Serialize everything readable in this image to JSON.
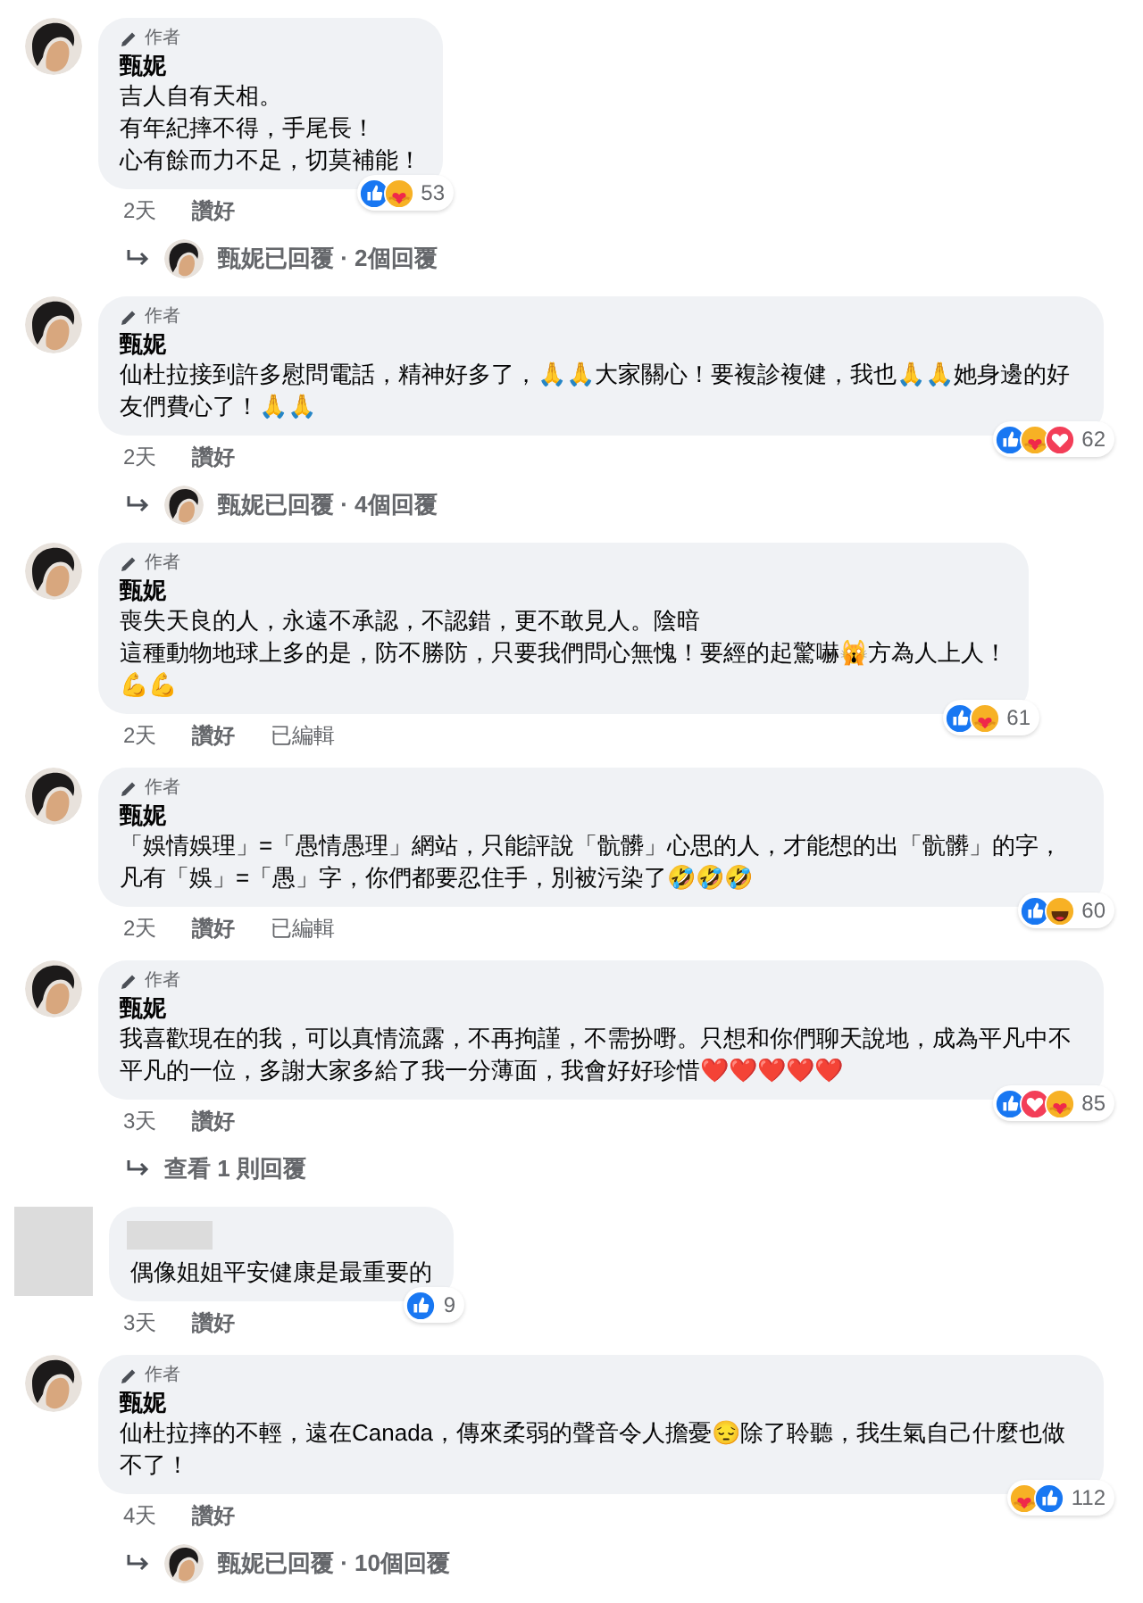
{
  "comments": [
    {
      "redacted_author": false,
      "badge": "作者",
      "name": "甄妮",
      "lines": [
        "吉人自有天相。",
        "有年紀摔不得，手尾長！",
        "心有餘而力不足，切莫補能！"
      ],
      "time": "2天",
      "actions": [
        "讚好"
      ],
      "reactions": [
        {
          "kind": "like"
        },
        {
          "kind": "care"
        }
      ],
      "reaction_count": "53",
      "replies": {
        "kind": "author",
        "text": "甄妮已回覆 · 2個回覆"
      }
    },
    {
      "redacted_author": false,
      "badge": "作者",
      "name": "甄妮",
      "lines": [
        "仙杜拉接到許多慰問電話，精神好多了，🙏🙏大家關心！要複診複健，我也🙏🙏她身邊的好友們費心了！🙏🙏"
      ],
      "time": "2天",
      "actions": [
        "讚好"
      ],
      "reactions": [
        {
          "kind": "like"
        },
        {
          "kind": "care"
        },
        {
          "kind": "love"
        }
      ],
      "reaction_count": "62",
      "replies": {
        "kind": "author",
        "text": "甄妮已回覆 · 4個回覆"
      }
    },
    {
      "redacted_author": false,
      "badge": "作者",
      "name": "甄妮",
      "lines": [
        "喪失天良的人，永遠不承認，不認錯，更不敢見人。陰暗",
        "這種動物地球上多的是，防不勝防，只要我們問心無愧！要經的起驚嚇🙀方為人上人！",
        "💪💪"
      ],
      "time": "2天",
      "actions": [
        "讚好",
        "已編輯"
      ],
      "reactions": [
        {
          "kind": "like"
        },
        {
          "kind": "care"
        }
      ],
      "reaction_count": "61"
    },
    {
      "redacted_author": false,
      "badge": "作者",
      "name": "甄妮",
      "lines": [
        "「娛情娛理」=「愚情愚理」網站，只能評說「骯髒」心思的人，才能想的出「骯髒」的字，凡有「娛」=「愚」字，你們都要忍住手，別被污染了🤣🤣🤣"
      ],
      "time": "2天",
      "actions": [
        "讚好",
        "已編輯"
      ],
      "reactions": [
        {
          "kind": "like"
        },
        {
          "kind": "haha"
        }
      ],
      "reaction_count": "60"
    },
    {
      "redacted_author": false,
      "badge": "作者",
      "name": "甄妮",
      "lines": [
        "我喜歡現在的我，可以真情流露，不再拘謹，不需扮嘢。只想和你們聊天說地，成為平凡中不平凡的一位，多謝大家多給了我一分薄面，我會好好珍惜❤️❤️❤️❤️❤️"
      ],
      "time": "3天",
      "actions": [
        "讚好"
      ],
      "reactions": [
        {
          "kind": "like"
        },
        {
          "kind": "love"
        },
        {
          "kind": "care"
        }
      ],
      "reaction_count": "85",
      "replies": {
        "kind": "plain",
        "text": "查看 1 則回覆"
      }
    },
    {
      "redacted_author": true,
      "lines": [
        "偶像姐姐平安健康是最重要的"
      ],
      "time": "3天",
      "actions": [
        "讚好"
      ],
      "reactions": [
        {
          "kind": "like"
        }
      ],
      "reaction_count": "9"
    },
    {
      "redacted_author": false,
      "badge": "作者",
      "name": "甄妮",
      "lines": [
        "仙杜拉摔的不輕，遠在Canada，傳來柔弱的聲音令人擔憂😔除了聆聽，我生氣自己什麼也做不了！"
      ],
      "time": "4天",
      "actions": [
        "讚好"
      ],
      "reactions": [
        {
          "kind": "care"
        },
        {
          "kind": "like"
        }
      ],
      "reaction_count": "112",
      "replies": {
        "kind": "author",
        "text": "甄妮已回覆 · 10個回覆"
      }
    }
  ]
}
